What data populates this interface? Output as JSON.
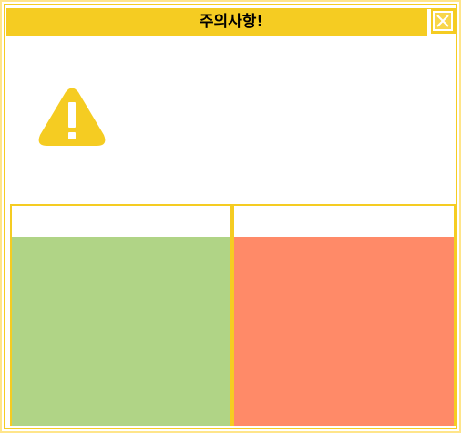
{
  "window": {
    "title": "주의사항!"
  },
  "icons": {
    "close": "close-icon",
    "warning": "warning-icon"
  },
  "panels": {
    "left": {
      "label": "",
      "color": "#b0d486"
    },
    "right": {
      "label": "",
      "color": "#ff8a68"
    }
  },
  "colors": {
    "accent": "#f5cc22",
    "border_light": "#ffe58a",
    "left_panel": "#b0d486",
    "right_panel": "#ff8a68"
  }
}
